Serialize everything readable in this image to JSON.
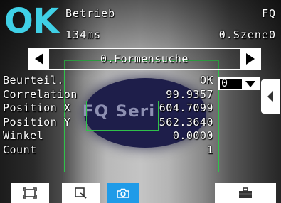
{
  "status": {
    "result": "OK",
    "mode": "Betrieb",
    "time": "134ms",
    "device": "FQ",
    "scene": "0.Szene0"
  },
  "camera_view": {
    "label_text": "FQ Seri"
  },
  "inspection": {
    "item_label": "0.Formensuche"
  },
  "results": [
    {
      "label": "Beurteil.",
      "value": "OK"
    },
    {
      "label": "Correlation",
      "value": "99.9357"
    },
    {
      "label": "Position X",
      "value": "604.7099"
    },
    {
      "label": "Position Y",
      "value": "562.3640"
    },
    {
      "label": "Winkel",
      "value": "0.0000"
    },
    {
      "label": "Count",
      "value": "1"
    }
  ],
  "selector": {
    "value": "0"
  },
  "colors": {
    "ok": "#3fd0e6",
    "roi": "#2fc24a",
    "active_tool": "#1f9be8"
  },
  "toolbar": [
    {
      "icon": "fit-screen-icon"
    },
    {
      "icon": "zoom-icon"
    },
    {
      "icon": "camera-icon"
    },
    {
      "icon": "toolbox-icon"
    }
  ]
}
